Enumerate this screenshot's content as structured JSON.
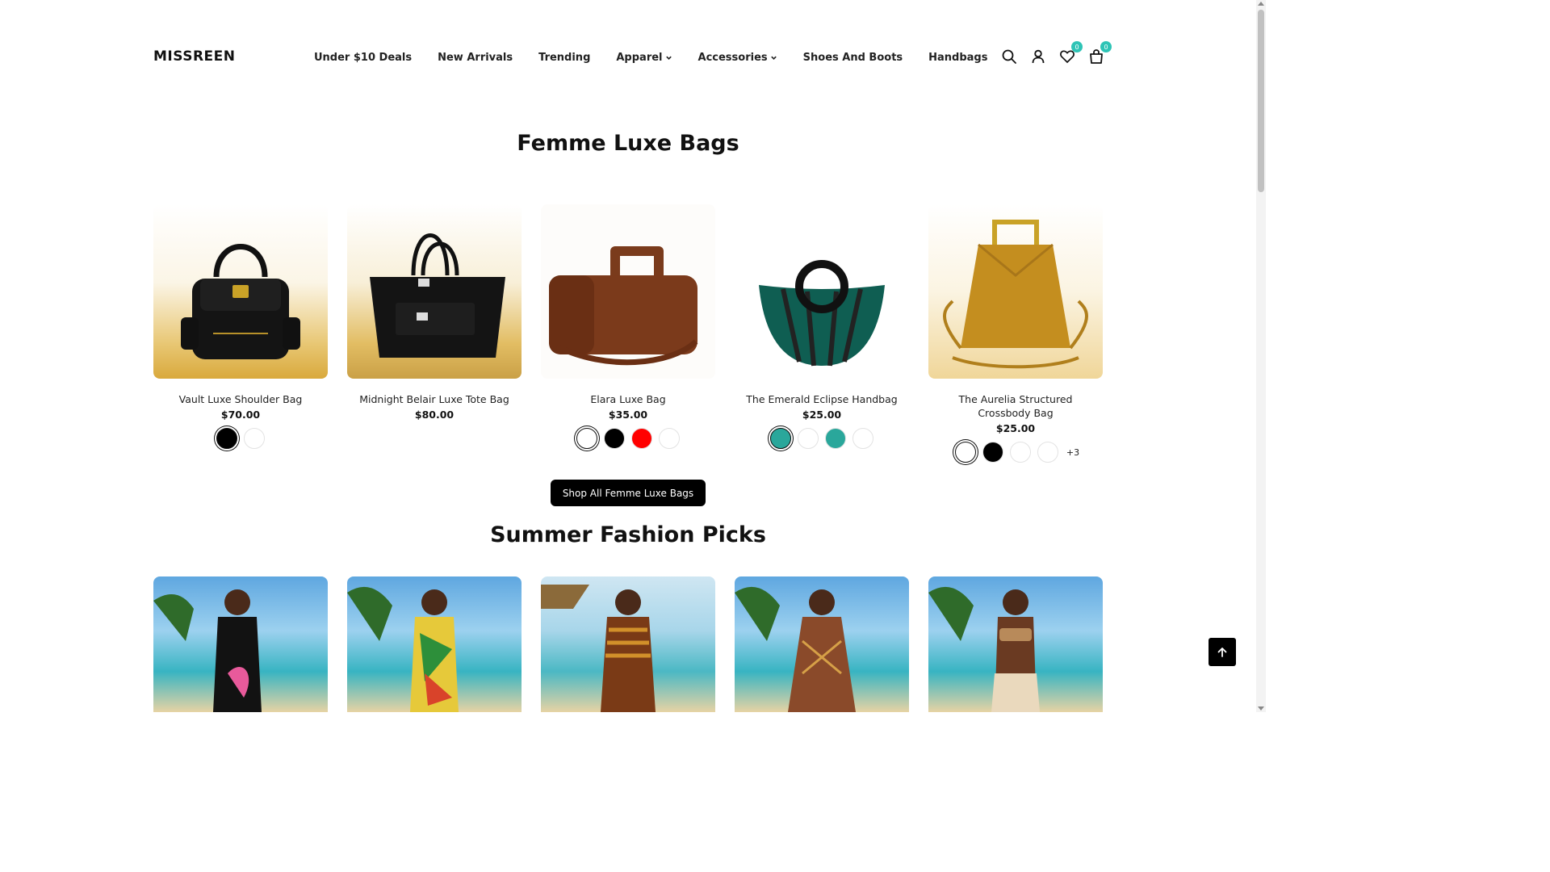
{
  "header": {
    "logo": "MISSREEN",
    "nav": [
      {
        "label": "Under $10 Deals",
        "dropdown": false
      },
      {
        "label": "New Arrivals",
        "dropdown": false
      },
      {
        "label": "Trending",
        "dropdown": false
      },
      {
        "label": "Apparel",
        "dropdown": true
      },
      {
        "label": "Accessories",
        "dropdown": true
      },
      {
        "label": "Shoes And Boots",
        "dropdown": false
      },
      {
        "label": "Handbags",
        "dropdown": false
      }
    ],
    "wishlist_count": "0",
    "cart_count": "0"
  },
  "sections": {
    "bags_title": "Femme Luxe Bags",
    "summer_title": "Summer Fashion Picks",
    "shop_all_label": "Shop All Femme Luxe Bags"
  },
  "products": [
    {
      "name": "Vault Luxe Shoulder Bag",
      "price": "$70.00",
      "image_icon": "black-shoulder-bag",
      "swatches": [
        {
          "color": "#000000",
          "selected": true
        },
        {
          "color": "#ffffff",
          "selected": false
        }
      ],
      "more": ""
    },
    {
      "name": "Midnight Belair Luxe Tote Bag",
      "price": "$80.00",
      "image_icon": "black-tote-bag",
      "swatches": [],
      "more": ""
    },
    {
      "name": "Elara Luxe Bag",
      "price": "$35.00",
      "image_icon": "brown-box-bag",
      "swatches": [
        {
          "color": "#ffffff",
          "selected": true
        },
        {
          "color": "#000000",
          "selected": false
        },
        {
          "color": "#ff0000",
          "selected": false
        },
        {
          "color": "#ffffff",
          "selected": false
        }
      ],
      "more": ""
    },
    {
      "name": "The Emerald Eclipse Handbag",
      "price": "$25.00",
      "image_icon": "emerald-shell-handbag",
      "swatches": [
        {
          "color": "#2aa79b",
          "selected": true
        },
        {
          "color": "#ffffff",
          "selected": false
        },
        {
          "color": "#2aa79b",
          "selected": false
        },
        {
          "color": "#ffffff",
          "selected": false
        }
      ],
      "more": ""
    },
    {
      "name": "The Aurelia Structured Crossbody Bag",
      "price": "$25.00",
      "image_icon": "mustard-crossbody-bag",
      "swatches": [
        {
          "color": "#ffffff",
          "selected": true
        },
        {
          "color": "#000000",
          "selected": false
        },
        {
          "color": "#ffffff",
          "selected": false
        },
        {
          "color": "#ffffff",
          "selected": false
        }
      ],
      "more": "+3"
    }
  ],
  "summer": [
    {
      "image_icon": "black-floral-swimsuit-photo"
    },
    {
      "image_icon": "tropical-print-swimsuit-photo"
    },
    {
      "image_icon": "tribal-print-dress-photo"
    },
    {
      "image_icon": "patterned-mini-dress-photo"
    },
    {
      "image_icon": "tan-bikini-wrap-photo"
    }
  ],
  "colors": {
    "accent_badge": "#2ec4b6",
    "button_bg": "#000000"
  }
}
